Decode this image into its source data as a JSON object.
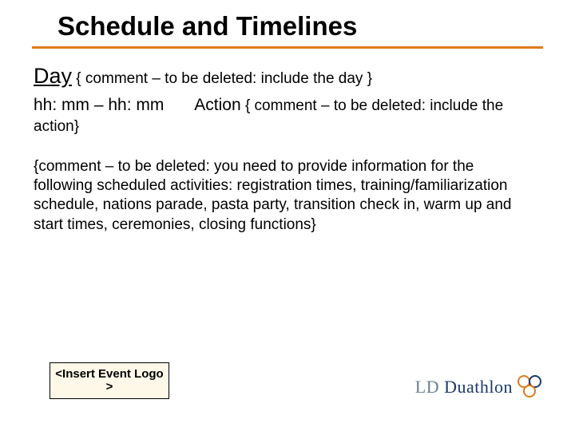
{
  "title": "Schedule and Timelines",
  "day": {
    "label": "Day",
    "comment": "{ comment – to be deleted: include the day }"
  },
  "row": {
    "time": "hh: mm – hh: mm",
    "action_label": "Action",
    "action_comment_head": "{ comment – to be deleted: include the",
    "action_comment_tail": "action}"
  },
  "blurb": "{comment – to be deleted: you need to provide information for the following scheduled activities: registration times, training/familiarization schedule, nations parade, pasta party, transition check in, warm up and start times, ceremonies, closing functions}",
  "logo_placeholder": "<Insert Event Logo >",
  "brand": {
    "ld": "LD",
    "du": " Duathlon"
  }
}
